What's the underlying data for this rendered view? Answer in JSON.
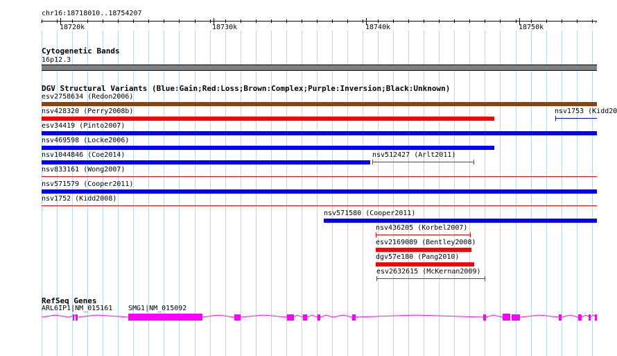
{
  "ruler": {
    "location": "chr16:18718010..18754207",
    "ticks": [
      {
        "label": "18720k"
      },
      {
        "label": "18730k"
      },
      {
        "label": "18740k"
      },
      {
        "label": "18750k"
      }
    ]
  },
  "cytoband": {
    "title": "Cytogenetic Bands",
    "band": "16p12.3",
    "color": "#808080"
  },
  "dgv": {
    "title": "DGV Structural Variants (Blue:Gain;Red:Loss;Brown:Complex;Purple:Inversion;Black:Unknown)",
    "colors": {
      "gain": "#0000ff",
      "loss": "#ff0000",
      "complex": "#8b4513"
    },
    "features": [
      {
        "label": "esv2758634 (Redon2006)",
        "type": "complex"
      },
      {
        "label": "nsv428320 (Perry2008b)",
        "type": "loss"
      },
      {
        "label": "nsv1753 (Kidd20",
        "type": "gain"
      },
      {
        "label": "esv34419 (Pinto2007)",
        "type": "gain"
      },
      {
        "label": "nsv469598 (Locke2006)",
        "type": "gain"
      },
      {
        "label": "nsv1044846 (Coe2014)",
        "type": "gain"
      },
      {
        "label": "nsv512427 (Arlt2011)",
        "type": "loss"
      },
      {
        "label": "nsv833161 (Wong2007)",
        "type": "loss"
      },
      {
        "label": "nsv571579 (Cooper2011)",
        "type": "gain"
      },
      {
        "label": "nsv1752 (Kidd2008)",
        "type": "loss"
      },
      {
        "label": "nsv571580 (Cooper2011)",
        "type": "gain"
      },
      {
        "label": "nsv436205 (Korbel2007)",
        "type": "loss"
      },
      {
        "label": "esv2169089 (Bentley2008)",
        "type": "loss"
      },
      {
        "label": "dgv57e180 (Pang2010)",
        "type": "loss"
      },
      {
        "label": "esv2632615 (McKernan2009)",
        "type": "loss"
      }
    ]
  },
  "refseq": {
    "title": "RefSeq Genes",
    "color": "#ff00ff",
    "genes": [
      {
        "label": "ARL6IP1|NM_015161"
      },
      {
        "label": "SMG1|NM_015092"
      }
    ]
  }
}
